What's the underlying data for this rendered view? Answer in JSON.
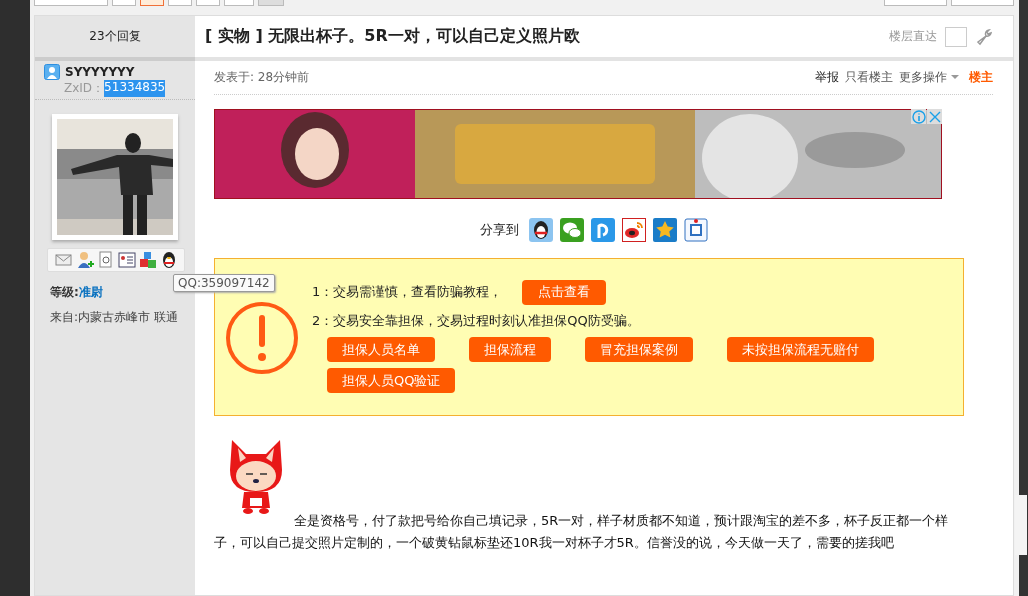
{
  "pager": [
    {
      "selected": false
    },
    {
      "selected": true
    },
    {
      "selected": false
    },
    {
      "selected": false
    }
  ],
  "thread": {
    "reply_count": "23个回复",
    "tag": "[ 实物 ]",
    "title": "无限出杯子。5R一对，可以自己定义照片欧",
    "jump_label": "楼层直达"
  },
  "author": {
    "name": "SYYYYYYY",
    "id_label": "ZxID：",
    "id": "51334835",
    "level_label": "等级:",
    "level": "准尉",
    "from": "来自:内蒙古赤峰市 联通",
    "tooltip": "QQ:359097142"
  },
  "post": {
    "time": "发表于: 28分钟前",
    "actions": [
      "举报",
      "只看楼主",
      "更多操作"
    ],
    "owner_badge": "楼主",
    "share_label": "分享到",
    "notice": {
      "line1": "1：交易需谨慎，查看防骗教程，",
      "line1_button": "点击查看",
      "line2": "2：交易安全靠担保，交易过程时刻认准担保QQ防受骗。",
      "buttons": [
        "担保人员名单",
        "担保流程",
        "冒充担保案例",
        "未按担保流程无赔付",
        "担保人员QQ验证"
      ]
    },
    "body": "全是资格号，付了款把号给你自己填记录，5R一对，样子材质都不知道，预计跟淘宝的差不多，杯子反正都一个样子，可以自己提交照片定制的，一个破黄钻鼠标垫还10R我一对杯子才5R。信誉没的说，今天做一天了，需要的搓我吧"
  }
}
